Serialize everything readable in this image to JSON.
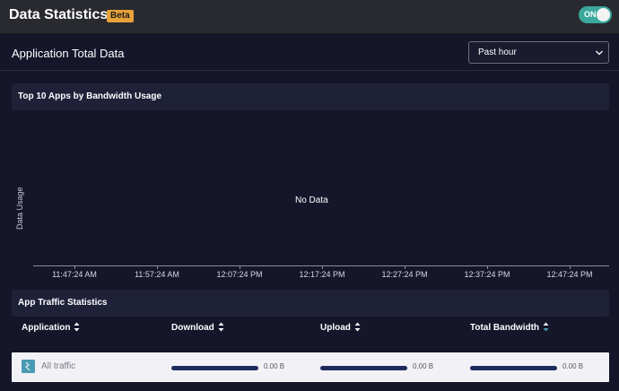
{
  "header": {
    "title": "Data Statistics",
    "badge": "Beta",
    "toggle_label": "ON"
  },
  "section": {
    "title": "Application Total Data",
    "time_range": "Past hour"
  },
  "chart_card": {
    "title": "Top 10 Apps by Bandwidth Usage"
  },
  "chart_data": {
    "type": "line",
    "title": "",
    "ylabel": "Data Usage",
    "xlabel": "",
    "x_ticks": [
      "11:47:24 AM",
      "11:57:24 AM",
      "12:07:24 PM",
      "12:17:24 PM",
      "12:27:24 PM",
      "12:37:24 PM",
      "12:47:24 PM"
    ],
    "series": [],
    "empty_message": "No Data",
    "grid": false
  },
  "traffic_card": {
    "title": "App Traffic Statistics"
  },
  "table": {
    "columns": [
      "Application",
      "Download",
      "Upload",
      "Total Bandwidth"
    ],
    "rows": [
      {
        "application": "All traffic",
        "download": "0.00 B",
        "upload": "0.00 B",
        "total": "0.00 B"
      }
    ]
  },
  "colors": {
    "accent": "#3aa89b",
    "badge": "#e8a23a",
    "bar": "#1f2a5c",
    "sort_active": "#4a9bb3"
  }
}
